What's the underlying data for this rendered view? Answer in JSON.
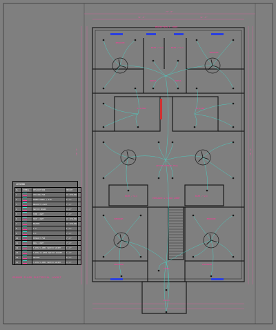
{
  "colors": {
    "background": "#7f7f7f",
    "wall": "#1a1a1a",
    "wire": "#3fe0d0",
    "label": "#ff3a9a",
    "dimension": "#e060a0",
    "window": "#2a3fe0",
    "door": "#d03030"
  },
  "plan": {
    "title": "GROUND FLOOR ELECTRICAL LAYOUT",
    "rooms": [
      {
        "id": "projection",
        "label": "PROJECTION 4' WIDE"
      },
      {
        "id": "bedroom-tl",
        "label": "BEDROOM"
      },
      {
        "id": "bedroom-tr",
        "label": "BEDROOM"
      },
      {
        "id": "bath-tl",
        "label": "BATH / W.C"
      },
      {
        "id": "bath-tr",
        "label": "BATH / W.C"
      },
      {
        "id": "dress-l",
        "label": "DRESS"
      },
      {
        "id": "dress-r",
        "label": "DRESS"
      },
      {
        "id": "kitchen-l",
        "label": "KITCHEN"
      },
      {
        "id": "kitchen-r",
        "label": "KITCHEN"
      },
      {
        "id": "living",
        "label": "LIVING/DINING HALL"
      },
      {
        "id": "bath-bl",
        "label": "BATH / W.C"
      },
      {
        "id": "bath-br",
        "label": "BATH / W.C"
      },
      {
        "id": "entrance",
        "label": "ENTRANCE & STAIR LOBBY"
      },
      {
        "id": "bedroom-bl",
        "label": "BEDROOM"
      },
      {
        "id": "bedroom-br",
        "label": "BEDROOM"
      },
      {
        "id": "verandah-l",
        "label": "VERANDAH"
      },
      {
        "id": "verandah-r",
        "label": "VERANDAH"
      },
      {
        "id": "lobby",
        "label": "LOBBY"
      },
      {
        "id": "porch",
        "label": "PORCH"
      }
    ]
  },
  "legend": {
    "title": "LEGEND",
    "headers": [
      "SL",
      "SYMBOL",
      "DESCRIPTION",
      "HEIGHT"
    ],
    "rows": [
      {
        "sl": "1",
        "symbol": "ceiling-fan",
        "desc": "CEILING FAN",
        "height": "AT CEILING"
      },
      {
        "sl": "2",
        "symbol": "db",
        "desc": "POWER PANEL / D.B",
        "height": "5'-0\""
      },
      {
        "sl": "3",
        "symbol": "bracket",
        "desc": "BRACKET LIGHT",
        "height": "7'-0\""
      },
      {
        "sl": "4",
        "symbol": "switch",
        "desc": "SWITCH BOARD",
        "height": "4'-0\""
      },
      {
        "sl": "5",
        "symbol": "tube",
        "desc": "TUBE LIGHT",
        "height": "7'-0\""
      },
      {
        "sl": "6",
        "symbol": "spot",
        "desc": "SPOT LIGHT",
        "height": "AT CEILING"
      },
      {
        "sl": "7",
        "symbol": "bell",
        "desc": "BUZZER",
        "height": "AT CEILING"
      },
      {
        "sl": "8",
        "symbol": "tv",
        "desc": "T.V",
        "height": "1'-6\""
      },
      {
        "sl": "9",
        "symbol": "ac",
        "desc": "A.C",
        "height": "7'-0\""
      },
      {
        "sl": "10",
        "symbol": "exhaust",
        "desc": "EXHAUST FAN",
        "height": "7'-0\""
      },
      {
        "sl": "11",
        "symbol": "wall",
        "desc": "WALL LIGHT",
        "height": "7'-0\""
      },
      {
        "sl": "12",
        "symbol": "s5",
        "desc": "5 PIN 5 AMPS SWITCH SOCKET",
        "height": "1'-0\""
      },
      {
        "sl": "13",
        "symbol": "s15",
        "desc": "5 PIN 15 AMPS SWITCH SOCKET",
        "height": "1'-0\""
      },
      {
        "sl": "14",
        "symbol": "geyser",
        "desc": "GEYSER",
        "height": "6'-0\""
      },
      {
        "sl": "15",
        "symbol": "s5h",
        "desc": "5 PIN 5 AMPS SWITCH SOCKET",
        "height": "4'-0\""
      }
    ]
  }
}
